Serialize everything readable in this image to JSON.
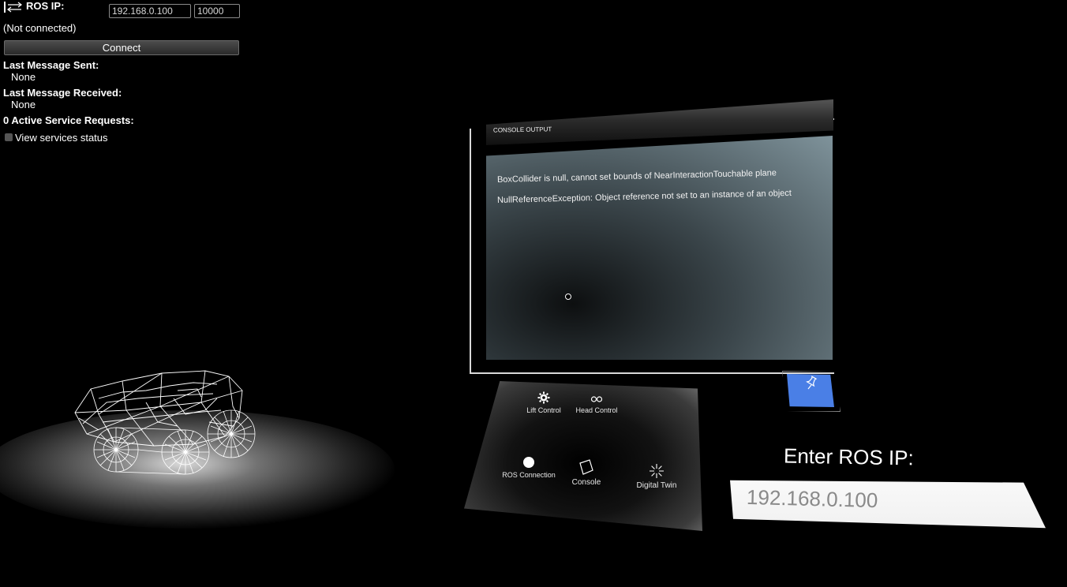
{
  "ros_panel": {
    "label": "ROS IP:",
    "ip_value": "192.168.0.100",
    "port_value": "10000",
    "status": "(Not connected)",
    "connect_label": "Connect",
    "last_sent_label": "Last Message Sent:",
    "last_sent_value": "None",
    "last_received_label": "Last Message Received:",
    "last_received_value": "None",
    "service_requests": "0 Active Service Requests:",
    "view_services_label": "View services status"
  },
  "console": {
    "title": "CONSOLE OUTPUT",
    "lines": [
      "BoxCollider is null, cannot set bounds of NearInteractionTouchable plane",
      "NullReferenceException: Object reference not set to an instance of an object"
    ]
  },
  "hand_menu": {
    "items": [
      {
        "label": "Lift Control",
        "icon": "gear-icon"
      },
      {
        "label": "Head Control",
        "icon": "glasses-icon"
      },
      {
        "label": "ROS Connection",
        "icon": "circle-icon"
      },
      {
        "label": "Console",
        "icon": "window-icon"
      },
      {
        "label": "Digital Twin",
        "icon": "sparkle-icon"
      }
    ]
  },
  "pin_button": {
    "icon": "pin-icon"
  },
  "enter_ip": {
    "title": "Enter ROS IP:",
    "value": "192.168.0.100"
  },
  "colors": {
    "pin_accent": "#4a7fe6",
    "background": "#000000"
  }
}
